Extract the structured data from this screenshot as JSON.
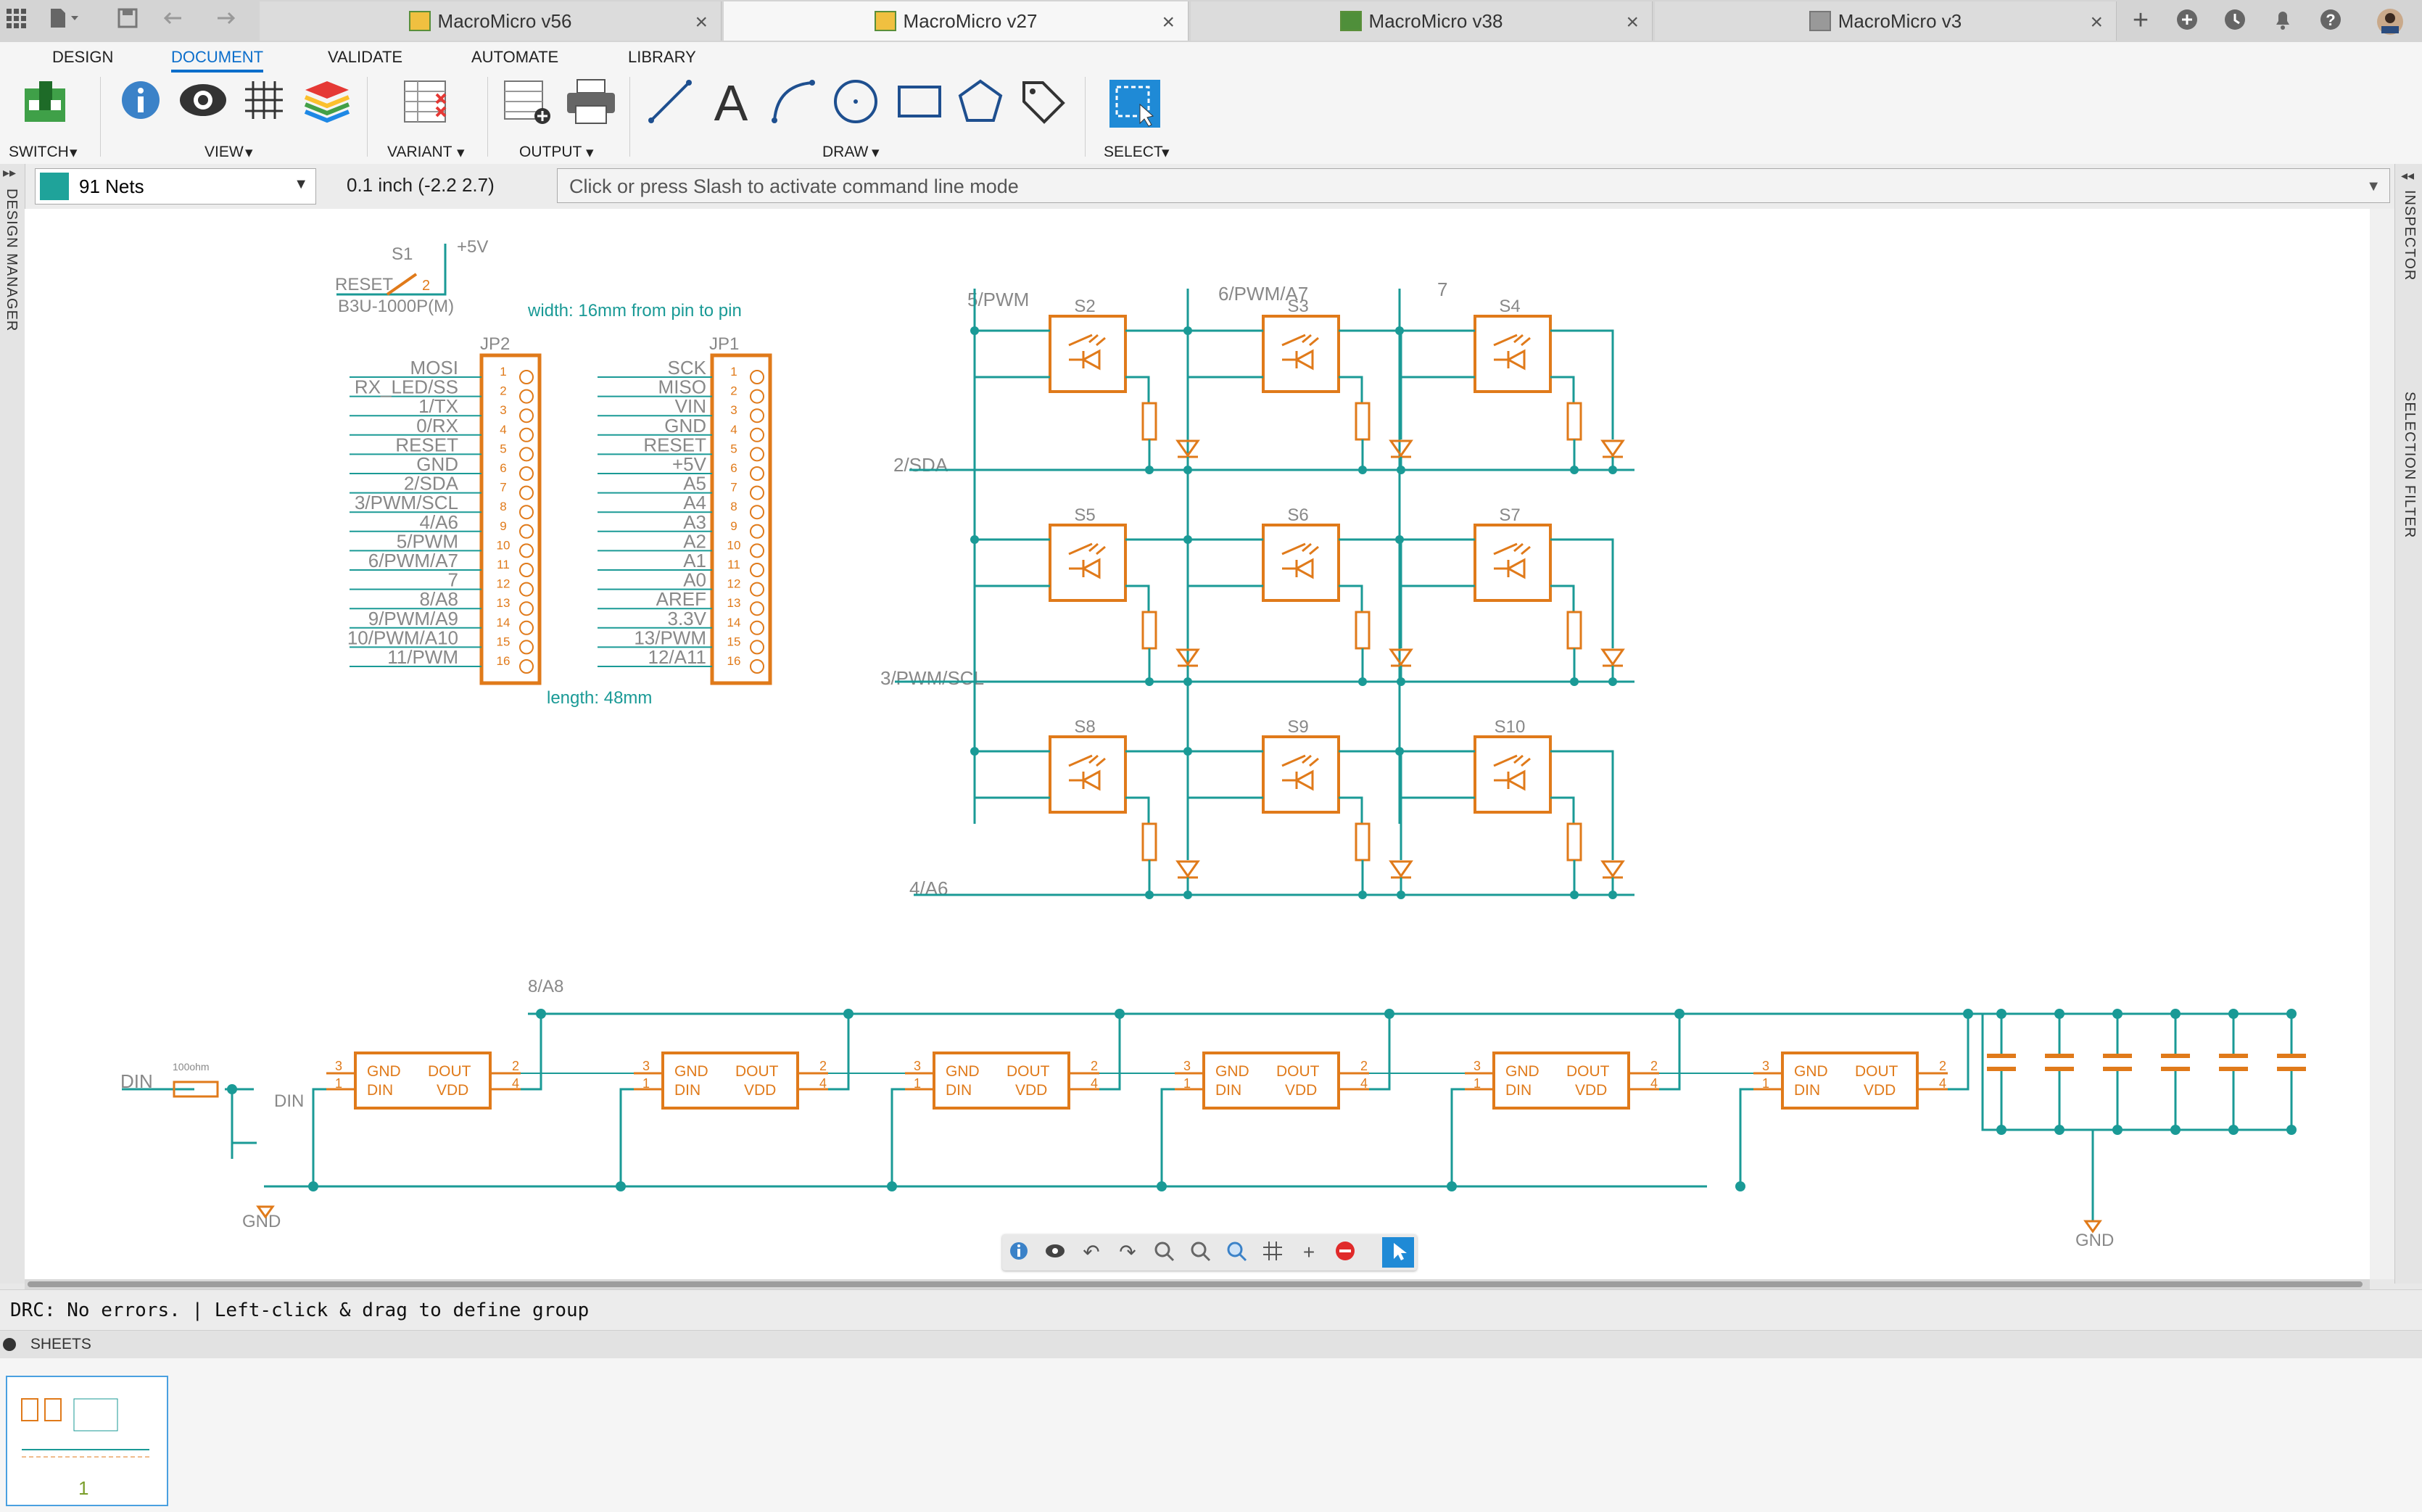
{
  "tabs": [
    {
      "label": "MacroMicro v56",
      "active": false
    },
    {
      "label": "MacroMicro v27",
      "active": true
    },
    {
      "label": "MacroMicro v38",
      "active": false
    },
    {
      "label": "MacroMicro v3",
      "active": false
    }
  ],
  "ribbon": {
    "tabs": [
      "DESIGN",
      "DOCUMENT",
      "VALIDATE",
      "AUTOMATE",
      "LIBRARY"
    ],
    "active_tab": "DOCUMENT",
    "groups": {
      "switch": "SWITCH",
      "view": "VIEW",
      "variant": "VARIANT",
      "output": "OUTPUT",
      "draw": "DRAW",
      "select": "SELECT"
    }
  },
  "command_row": {
    "net_selector": "91 Nets",
    "coordinates": "0.1 inch (-2.2 2.7)",
    "command_placeholder": "Click or press Slash to activate command line mode"
  },
  "side_panels": {
    "left": "DESIGN MANAGER",
    "right_top": "INSPECTOR",
    "right_bottom": "SELECTION FILTER"
  },
  "status_bar": "DRC: No errors. | Left-click & drag to define group",
  "sheets": {
    "header": "SHEETS",
    "page_number": "1"
  },
  "colors": {
    "accent": "#0b6ecb",
    "schematic_part": "#e07a1a",
    "schematic_net": "#1a9a96",
    "ribbon_bg": "#f5f5f5"
  },
  "schematic": {
    "reset_switch": {
      "name": "S1",
      "net": "RESET",
      "supply": "+5V",
      "value": "B3U-1000P(M)",
      "pin": "2"
    },
    "header_note": "width: 16mm from pin to pin",
    "length_note": "length: 48mm",
    "jp2": {
      "name": "JP2",
      "pins": [
        "1",
        "2",
        "3",
        "4",
        "5",
        "6",
        "7",
        "8",
        "9",
        "10",
        "11",
        "12",
        "13",
        "14",
        "15",
        "16"
      ],
      "nets": [
        "MOSI",
        "RX_LED/SS",
        "1/TX",
        "0/RX",
        "RESET",
        "GND",
        "2/SDA",
        "3/PWM/SCL",
        "4/A6",
        "5/PWM",
        "6/PWM/A7",
        "7",
        "8/A8",
        "9/PWM/A9",
        "10/PWM/A10",
        "11/PWM"
      ]
    },
    "jp1": {
      "name": "JP1",
      "pins": [
        "1",
        "2",
        "3",
        "4",
        "5",
        "6",
        "7",
        "8",
        "9",
        "10",
        "11",
        "12",
        "13",
        "14",
        "15",
        "16"
      ],
      "nets": [
        "SCK",
        "MISO",
        "VIN",
        "GND",
        "RESET",
        "+5V",
        "A5",
        "A4",
        "A3",
        "A2",
        "A1",
        "A0",
        "AREF",
        "3.3V",
        "13/PWM",
        "12/A11"
      ]
    },
    "matrix": {
      "column_nets": [
        "5/PWM",
        "6/PWM/A7",
        "7"
      ],
      "row_nets": [
        "2/SDA",
        "3/PWM/SCL",
        "4/A6"
      ],
      "switches": [
        "S2",
        "S3",
        "S4",
        "S5",
        "S6",
        "S7",
        "S8",
        "S9",
        "S10"
      ]
    },
    "led_chain": {
      "data_in": "DIN",
      "data_in_local": "DIN",
      "resistor_value": "100ohm",
      "top_net": "8/A8",
      "ground": "GND",
      "ground_right": "GND",
      "pin_labels": {
        "gnd": "GND",
        "dout": "DOUT",
        "din": "DIN",
        "vdd": "VDD"
      },
      "pin_numbers": [
        "3",
        "1",
        "2",
        "4"
      ],
      "count": 6,
      "capacitor_count": 6
    }
  }
}
